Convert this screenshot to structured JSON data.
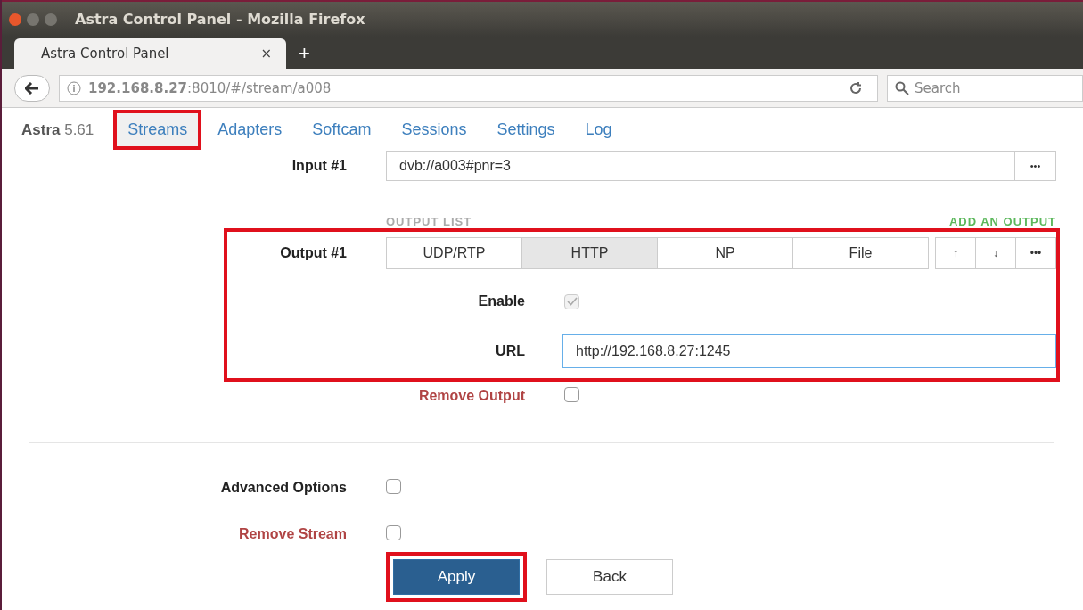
{
  "window": {
    "title": "Astra Control Panel - Mozilla Firefox"
  },
  "browser_tab": {
    "title": "Astra Control Panel",
    "close": "×",
    "new_tab": "+"
  },
  "address_bar": {
    "url": "**192.168.8.27**:8010/#/stream/a008"
  },
  "search": {
    "placeholder": "Search"
  },
  "nav": {
    "brand": "**Astra** 5.61",
    "items": [
      {
        "label": "Streams",
        "selected": true,
        "highlighted": true
      },
      {
        "label": "Adapters",
        "selected": false,
        "highlighted": false
      },
      {
        "label": "Softcam",
        "selected": false,
        "highlighted": false
      },
      {
        "label": "Sessions",
        "selected": false,
        "highlighted": false
      },
      {
        "label": "Settings",
        "selected": false,
        "highlighted": false
      },
      {
        "label": "Log",
        "selected": false,
        "highlighted": false
      }
    ]
  },
  "input": {
    "label": "Input #1",
    "value": "dvb://a003#pnr=3",
    "more": "•••"
  },
  "output_list": {
    "heading": "OUTPUT LIST",
    "add": "ADD AN OUTPUT"
  },
  "output": {
    "label": "Output #1",
    "highlighted": true,
    "types": [
      {
        "label": "UDP/RTP",
        "selected": false
      },
      {
        "label": "HTTP",
        "selected": true
      },
      {
        "label": "NP",
        "selected": false
      },
      {
        "label": "File",
        "selected": false
      }
    ],
    "actions": [
      "↑",
      "↓",
      "•••"
    ],
    "enable": {
      "label": "Enable",
      "checked": true,
      "disabled": true
    },
    "url": {
      "label": "URL",
      "value": "http://192.168.8.27:1245"
    },
    "remove": {
      "label": "Remove Output",
      "checked": false
    }
  },
  "options": [
    {
      "label": "Advanced Options",
      "kind": "normal",
      "checked": false
    },
    {
      "label": "Remove Stream",
      "kind": "danger",
      "checked": false
    }
  ],
  "buttons": [
    {
      "label": "Apply",
      "kind": "primary",
      "highlighted": true
    },
    {
      "label": "Back",
      "kind": "default",
      "highlighted": false
    }
  ]
}
